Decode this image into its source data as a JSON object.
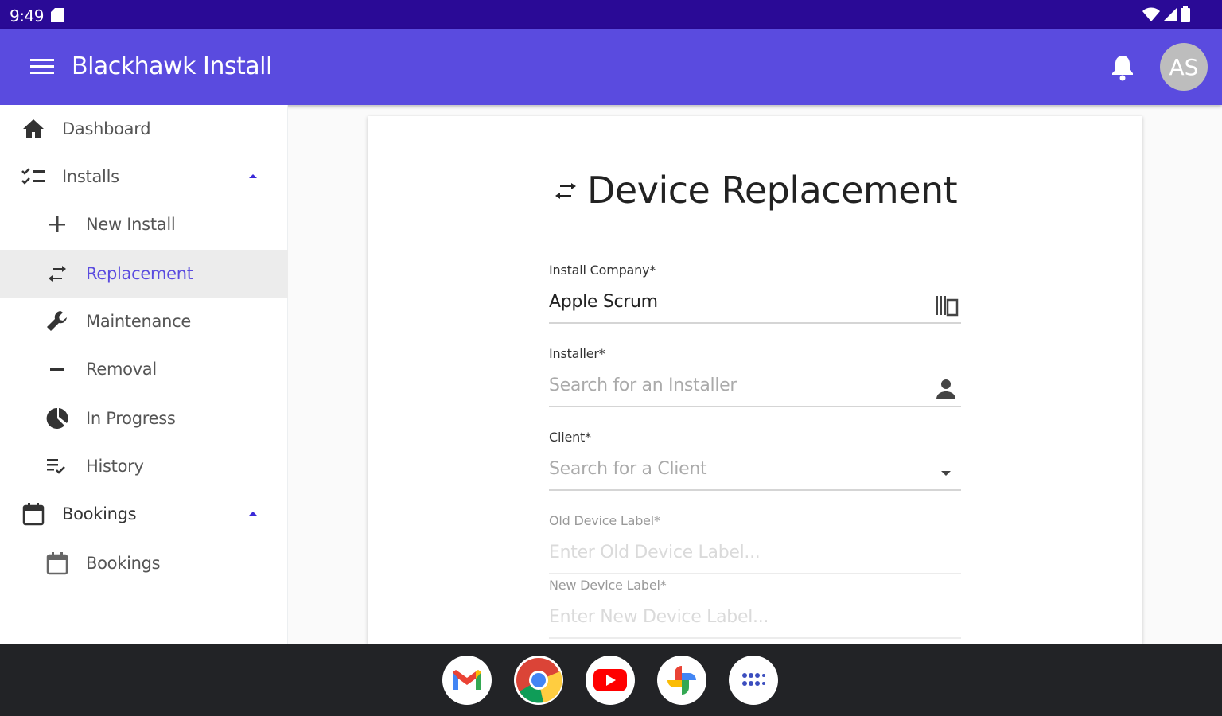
{
  "statusbar": {
    "time": "9:49"
  },
  "appbar": {
    "title": "Blackhawk Install",
    "avatar_initials": "AS"
  },
  "sidebar": {
    "items": [
      {
        "label": "Dashboard",
        "icon": "home-icon"
      },
      {
        "label": "Installs",
        "icon": "checklist-icon",
        "expanded": true
      },
      {
        "label": "New Install",
        "icon": "plus-icon"
      },
      {
        "label": "Replacement",
        "icon": "swap-icon",
        "active": true
      },
      {
        "label": "Maintenance",
        "icon": "wrench-icon"
      },
      {
        "label": "Removal",
        "icon": "minus-icon"
      },
      {
        "label": "In Progress",
        "icon": "pie-icon"
      },
      {
        "label": "History",
        "icon": "history-list-icon"
      },
      {
        "label": "Bookings",
        "icon": "calendar-icon",
        "expanded": true
      },
      {
        "label": "Bookings",
        "icon": "calendar-icon"
      }
    ]
  },
  "form": {
    "title": "Device Replacement",
    "install_company": {
      "label": "Install Company*",
      "value": "Apple Scrum"
    },
    "installer": {
      "label": "Installer*",
      "placeholder": "Search for an Installer"
    },
    "client": {
      "label": "Client*",
      "placeholder": "Search for a Client"
    },
    "old_device": {
      "label": "Old Device Label*",
      "placeholder": "Enter Old Device Label..."
    },
    "new_device": {
      "label": "New Device Label*",
      "placeholder": "Enter New Device Label..."
    }
  },
  "dock": {
    "apps": [
      "gmail-icon",
      "chrome-icon",
      "youtube-icon",
      "photos-icon",
      "app-launcher-icon"
    ]
  },
  "colors": {
    "status_bar": "#2a0a96",
    "app_bar": "#5a4bdf",
    "accent": "#5a4bdf",
    "taskbar": "#222326"
  }
}
